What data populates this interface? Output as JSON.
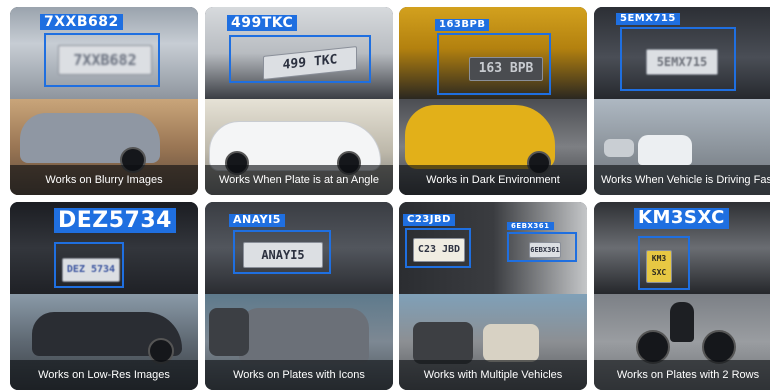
{
  "cards": [
    {
      "detected": "7XXB682",
      "plate": "7XXB682",
      "caption": "Works on Blurry Images"
    },
    {
      "detected": "499TKC",
      "plate": "499 TKC",
      "caption": "Works When Plate is at an Angle"
    },
    {
      "detected": "163BPB",
      "plate": "163 BPB",
      "caption": "Works in Dark Environment"
    },
    {
      "detected": "5EMX715",
      "plate": "5EMX715",
      "caption": "Works When Vehicle is Driving Fast"
    },
    {
      "detected": "DEZ5734",
      "plate": "DEZ 5734",
      "caption": "Works on Low-Res Images"
    },
    {
      "detected": "ANAYI5",
      "plate": "ANAYI5",
      "caption": "Works on Plates with Icons"
    },
    {
      "detected_1": "C23JBD",
      "plate_1": "C23 JBD",
      "detected_2": "6EBX361",
      "plate_2": "6EBX361",
      "caption": "Works with Multiple Vehicles"
    },
    {
      "detected": "KM3SXC",
      "plate": "KM3 SXC",
      "caption": "Works on Plates with 2 Rows"
    }
  ],
  "colors": {
    "detection_box": "#1f6fe0",
    "caption_bg": "rgba(12,14,18,0.62)"
  }
}
